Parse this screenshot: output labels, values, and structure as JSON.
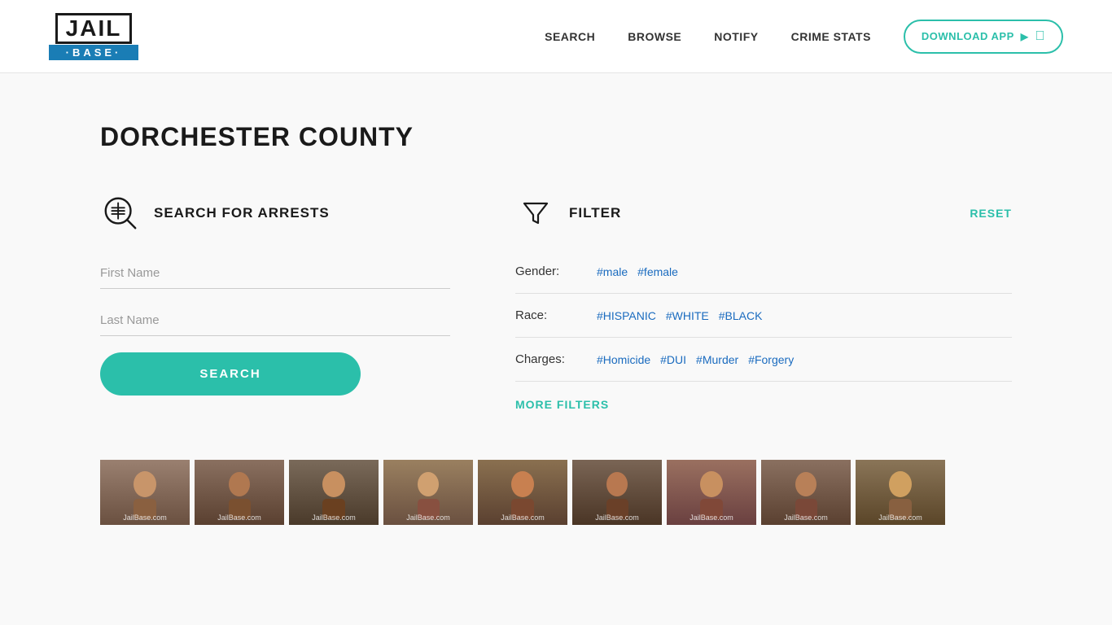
{
  "header": {
    "logo": {
      "jail_text": "JAIL",
      "base_text": "·BASE·"
    },
    "nav": {
      "items": [
        {
          "label": "SEARCH",
          "key": "search"
        },
        {
          "label": "BROWSE",
          "key": "browse"
        },
        {
          "label": "NOTIFY",
          "key": "notify"
        },
        {
          "label": "CRIME STATS",
          "key": "crime-stats"
        }
      ],
      "download_btn": "DOWNLOAD APP"
    }
  },
  "page": {
    "county_title": "DORCHESTER COUNTY"
  },
  "search_section": {
    "icon_label": "search-arrests-icon",
    "title": "SEARCH FOR ARRESTS",
    "first_name_placeholder": "First Name",
    "last_name_placeholder": "Last Name",
    "search_button": "SEARCH"
  },
  "filter_section": {
    "title": "FILTER",
    "reset_label": "RESET",
    "gender_label": "Gender:",
    "gender_tags": [
      "#male",
      "#female"
    ],
    "race_label": "Race:",
    "race_tags": [
      "#HISPANIC",
      "#WHITE",
      "#BLACK"
    ],
    "charges_label": "Charges:",
    "charges_tags": [
      "#Homicide",
      "#DUI",
      "#Murder",
      "#Forgery"
    ],
    "more_filters_label": "MORE FILTERS"
  },
  "mugshots": {
    "label": "JailBase.com",
    "colors": [
      "#7a6a5a",
      "#8a7060",
      "#6a5a4a",
      "#7a6a5a",
      "#8a6a50",
      "#7a6560",
      "#8a7060",
      "#7a6a5a",
      "#8a7560"
    ]
  }
}
